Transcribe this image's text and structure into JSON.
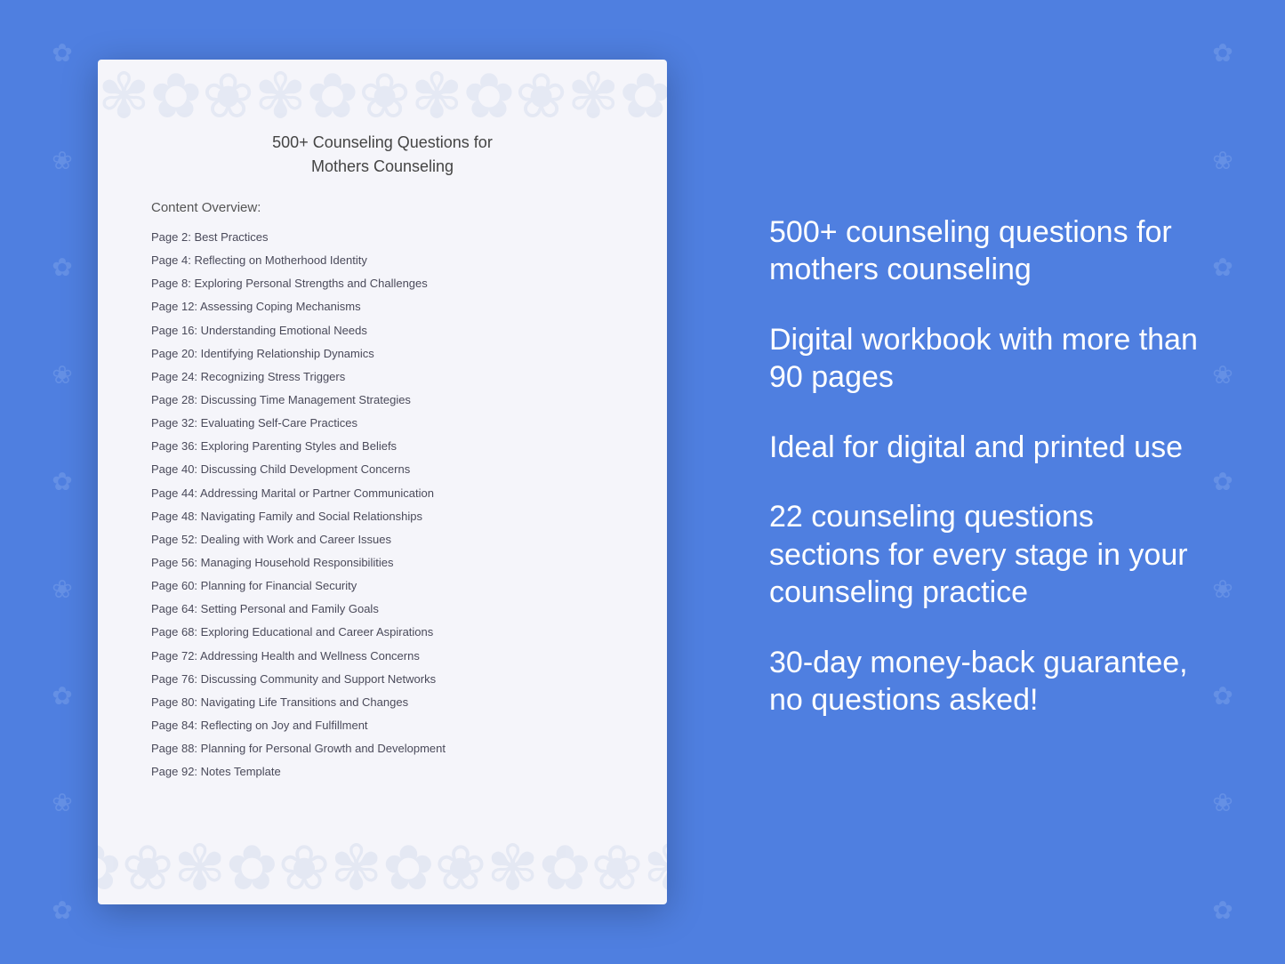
{
  "background_color": "#4f7fe0",
  "document": {
    "title_line1": "500+ Counseling Questions for",
    "title_line2": "Mothers Counseling",
    "content_overview_label": "Content Overview:",
    "toc_items": [
      {
        "page": "Page  2:",
        "topic": "Best Practices"
      },
      {
        "page": "Page  4:",
        "topic": "Reflecting on Motherhood Identity"
      },
      {
        "page": "Page  8:",
        "topic": "Exploring Personal Strengths and Challenges"
      },
      {
        "page": "Page 12:",
        "topic": "Assessing Coping Mechanisms"
      },
      {
        "page": "Page 16:",
        "topic": "Understanding Emotional Needs"
      },
      {
        "page": "Page 20:",
        "topic": "Identifying Relationship Dynamics"
      },
      {
        "page": "Page 24:",
        "topic": "Recognizing Stress Triggers"
      },
      {
        "page": "Page 28:",
        "topic": "Discussing Time Management Strategies"
      },
      {
        "page": "Page 32:",
        "topic": "Evaluating Self-Care Practices"
      },
      {
        "page": "Page 36:",
        "topic": "Exploring Parenting Styles and Beliefs"
      },
      {
        "page": "Page 40:",
        "topic": "Discussing Child Development Concerns"
      },
      {
        "page": "Page 44:",
        "topic": "Addressing Marital or Partner Communication"
      },
      {
        "page": "Page 48:",
        "topic": "Navigating Family and Social Relationships"
      },
      {
        "page": "Page 52:",
        "topic": "Dealing with Work and Career Issues"
      },
      {
        "page": "Page 56:",
        "topic": "Managing Household Responsibilities"
      },
      {
        "page": "Page 60:",
        "topic": "Planning for Financial Security"
      },
      {
        "page": "Page 64:",
        "topic": "Setting Personal and Family Goals"
      },
      {
        "page": "Page 68:",
        "topic": "Exploring Educational and Career Aspirations"
      },
      {
        "page": "Page 72:",
        "topic": "Addressing Health and Wellness Concerns"
      },
      {
        "page": "Page 76:",
        "topic": "Discussing Community and Support Networks"
      },
      {
        "page": "Page 80:",
        "topic": "Navigating Life Transitions and Changes"
      },
      {
        "page": "Page 84:",
        "topic": "Reflecting on Joy and Fulfillment"
      },
      {
        "page": "Page 88:",
        "topic": "Planning for Personal Growth and Development"
      },
      {
        "page": "Page 92:",
        "topic": "Notes Template"
      }
    ]
  },
  "info_blocks": [
    {
      "text": "500+ counseling questions for mothers counseling"
    },
    {
      "text": "Digital workbook with more than 90 pages"
    },
    {
      "text": "Ideal for digital and printed use"
    },
    {
      "text": "22 counseling questions sections for every stage in your counseling practice"
    },
    {
      "text": "30-day money-back guarantee, no questions asked!"
    }
  ]
}
